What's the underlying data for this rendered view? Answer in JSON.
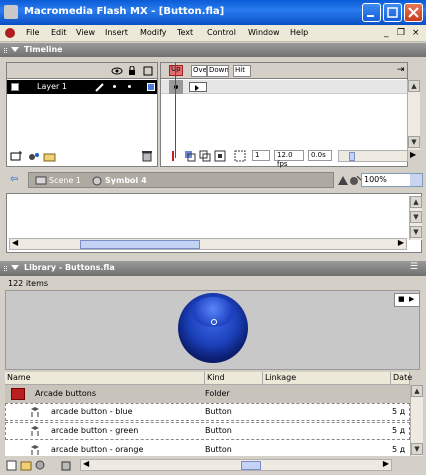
{
  "window": {
    "title": "Macromedia Flash MX - [Button.fla]",
    "controls": [
      "minimize",
      "maximize",
      "close"
    ]
  },
  "menu": {
    "items": [
      "File",
      "Edit",
      "View",
      "Insert",
      "Modify",
      "Text",
      "Control",
      "Window",
      "Help"
    ],
    "mdi_controls": [
      "_",
      "❐",
      "×"
    ]
  },
  "timeline": {
    "panel_title": "Timeline",
    "layer": {
      "name": "Layer 1"
    },
    "frame_labels": [
      "Up",
      "Over",
      "Down",
      "Hit"
    ],
    "current_frame": "1",
    "frame_rate": "12.0 fps",
    "elapsed_time": "0.0s"
  },
  "scene_bar": {
    "scene": "Scene 1",
    "symbol": "Symbol 4",
    "zoom": "100%"
  },
  "library": {
    "panel_title": "Library - Buttons.fla",
    "item_count": "122 items",
    "columns": [
      "Name",
      "Kind",
      "Linkage",
      "Date"
    ],
    "rows": [
      {
        "name": "Arcade buttons",
        "kind": "Folder",
        "date": ""
      },
      {
        "name": "arcade button - blue",
        "kind": "Button",
        "date": "5 д"
      },
      {
        "name": "arcade button - green",
        "kind": "Button",
        "date": "5 д"
      },
      {
        "name": "arcade button - orange",
        "kind": "Button",
        "date": "5 д"
      }
    ]
  },
  "colors": {
    "titlebar": "#0a5bd6",
    "panel_header": "#808080",
    "layer_selected": "#000000",
    "button_preview": "#1b3fb8"
  }
}
